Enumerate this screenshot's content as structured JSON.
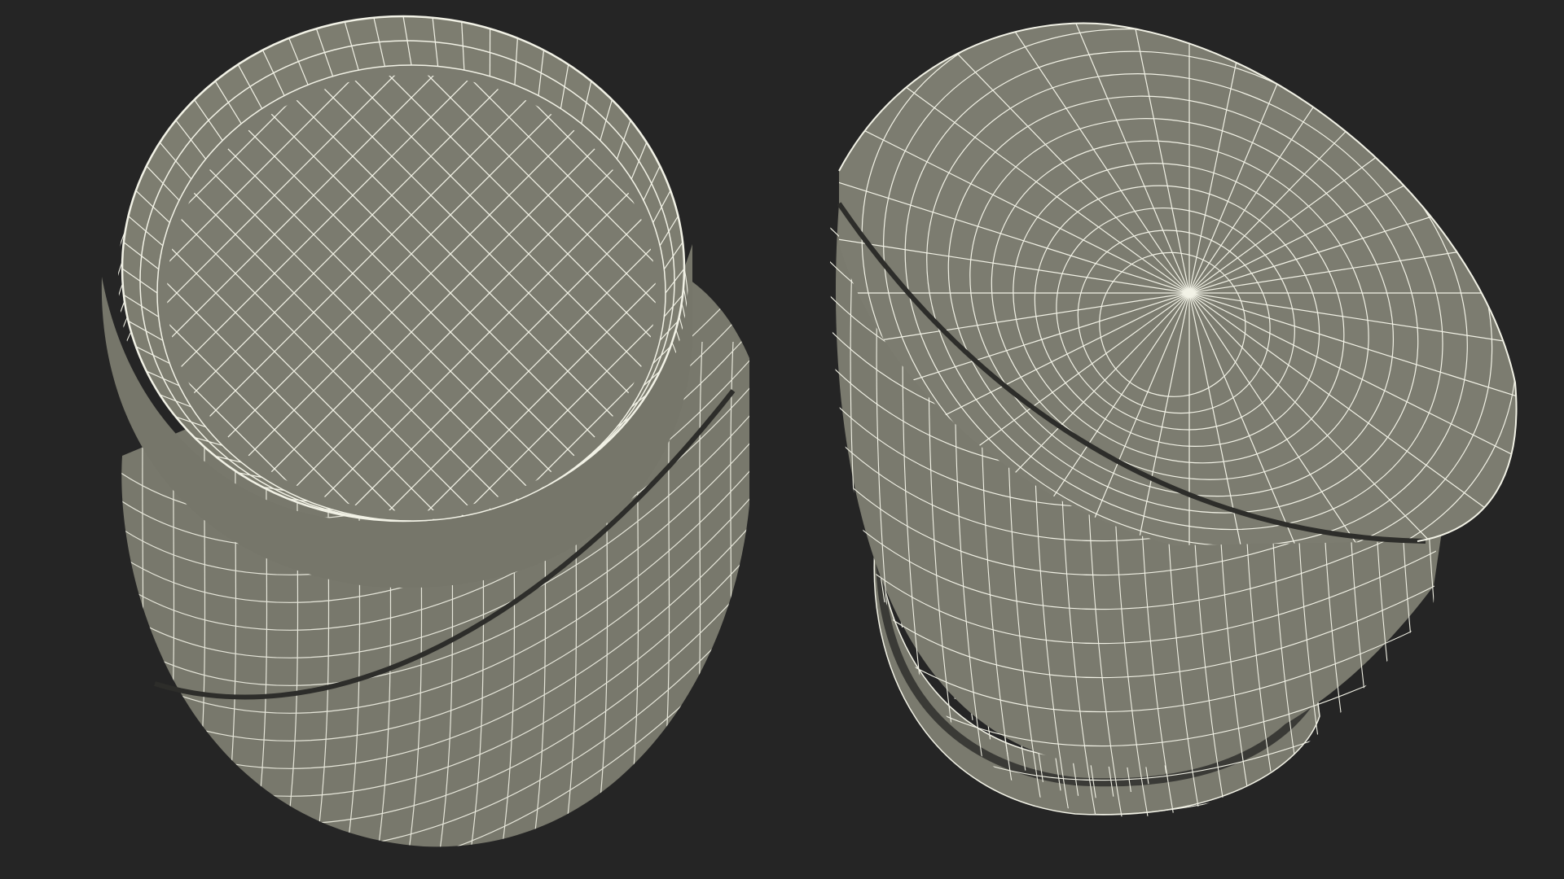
{
  "scene": {
    "background": "#252525",
    "mesh_fill": "#7d7d70",
    "mesh_fill_dark": "#6e6e62",
    "wire_color": "#f2f2e6",
    "groove_color": "#3a3a36"
  },
  "objects": [
    {
      "name": "jar-left",
      "view": "top-angled",
      "lid": "open-top-rim"
    },
    {
      "name": "jar-right",
      "view": "lid-angled",
      "lid": "domed-lid"
    }
  ]
}
